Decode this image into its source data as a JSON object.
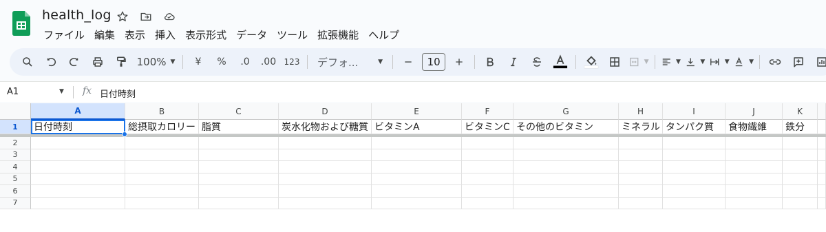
{
  "app": {
    "doc_title": "health_log"
  },
  "menu": [
    "ファイル",
    "編集",
    "表示",
    "挿入",
    "表示形式",
    "データ",
    "ツール",
    "拡張機能",
    "ヘルプ"
  ],
  "toolbar": {
    "zoom": "100%",
    "currency": "¥",
    "percent": "%",
    "dec_decrease": ".0",
    "dec_increase": ".00",
    "number_format": "123",
    "font": "デフォ...",
    "font_size": "10"
  },
  "formula_bar": {
    "cell_ref": "A1",
    "fx": "fx",
    "value": "日付時刻"
  },
  "columns": [
    "A",
    "B",
    "C",
    "D",
    "E",
    "F",
    "G",
    "H",
    "I",
    "J",
    "K"
  ],
  "rows": [
    "1",
    "2",
    "3",
    "4",
    "5",
    "6",
    "7"
  ],
  "row1_values": [
    "日付時刻",
    "総摂取カロリー",
    "脂質",
    "炭水化物および糖質",
    "ビタミンA",
    "ビタミンC",
    "その他のビタミン",
    "ミネラル",
    "タンパク質",
    "食物繊維",
    "鉄分"
  ],
  "colors": {
    "accent": "#1a73e8",
    "selected_header": "#d3e3fd",
    "logo_green": "#0f9d58"
  }
}
